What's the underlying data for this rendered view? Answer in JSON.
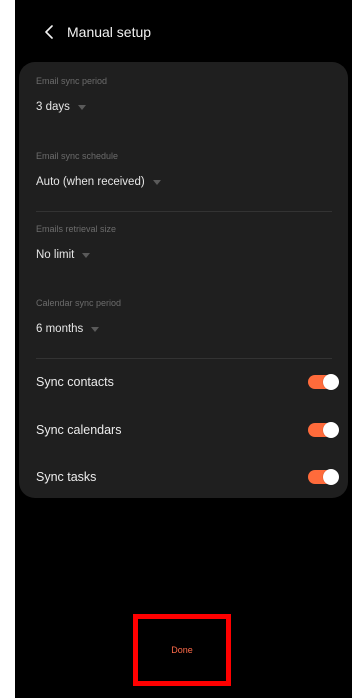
{
  "header": {
    "title": "Manual setup",
    "back_icon": "chevron-left-icon"
  },
  "settings": [
    {
      "label": "Email sync period",
      "value": "3 days"
    },
    {
      "label": "Email sync schedule",
      "value": "Auto (when received)"
    },
    {
      "label": "Emails retrieval size",
      "value": "No limit"
    },
    {
      "label": "Calendar sync period",
      "value": "6 months"
    }
  ],
  "toggles": [
    {
      "label": "Sync contacts",
      "on": true
    },
    {
      "label": "Sync calendars",
      "on": true
    },
    {
      "label": "Sync tasks",
      "on": true
    }
  ],
  "footer": {
    "done_label": "Done"
  },
  "colors": {
    "background": "#000000",
    "card": "#1f1f1f",
    "accent": "#ff6b3b",
    "highlight_border": "#ff0000"
  }
}
